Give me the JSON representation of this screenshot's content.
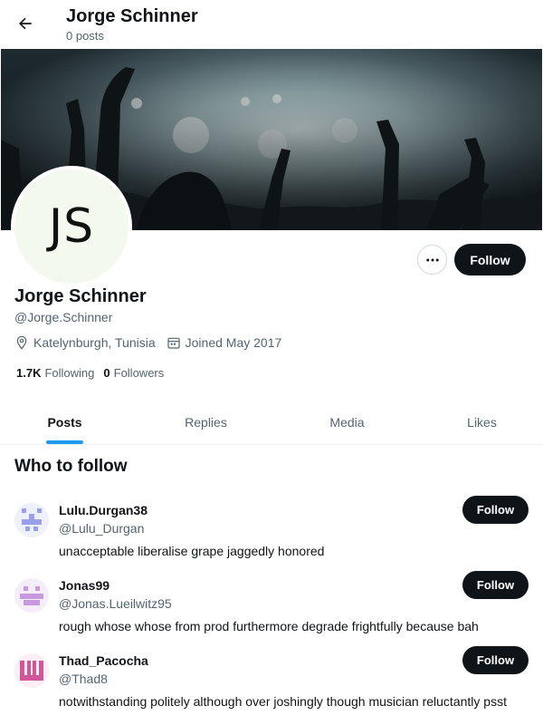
{
  "header": {
    "name": "Jorge Schinner",
    "post_count": "0 posts"
  },
  "profile": {
    "initials": "JS",
    "name": "Jorge Schinner",
    "handle": "@Jorge.Schinner",
    "location": "Katelynburgh, Tunisia",
    "joined": "Joined May 2017",
    "following_count": "1.7K",
    "following_label": "Following",
    "followers_count": "0",
    "followers_label": "Followers",
    "follow_label": "Follow"
  },
  "tabs": [
    {
      "label": "Posts",
      "active": true
    },
    {
      "label": "Replies",
      "active": false
    },
    {
      "label": "Media",
      "active": false
    },
    {
      "label": "Likes",
      "active": false
    }
  ],
  "who_to_follow": {
    "title": "Who to follow",
    "suggestions": [
      {
        "name": "Lulu.Durgan38",
        "handle": "@Lulu_Durgan",
        "bio": "unacceptable liberalise grape jaggedly honored",
        "follow_label": "Follow",
        "avatar_color": "#9aa0e8"
      },
      {
        "name": "Jonas99",
        "handle": "@Jonas.Lueilwitz95",
        "bio": "rough whose whose from prod furthermore degrade frightfully because bah",
        "follow_label": "Follow",
        "avatar_color": "#c79ae0"
      },
      {
        "name": "Thad_Pacocha",
        "handle": "@Thad8",
        "bio": "notwithstanding politely although over joshingly though musician reluctantly psst",
        "follow_label": "Follow",
        "avatar_color": "#d2579a"
      }
    ]
  },
  "icons": {
    "back": "arrow-left-icon",
    "more": "more-dots-icon",
    "location": "location-pin-icon",
    "calendar": "calendar-icon"
  }
}
